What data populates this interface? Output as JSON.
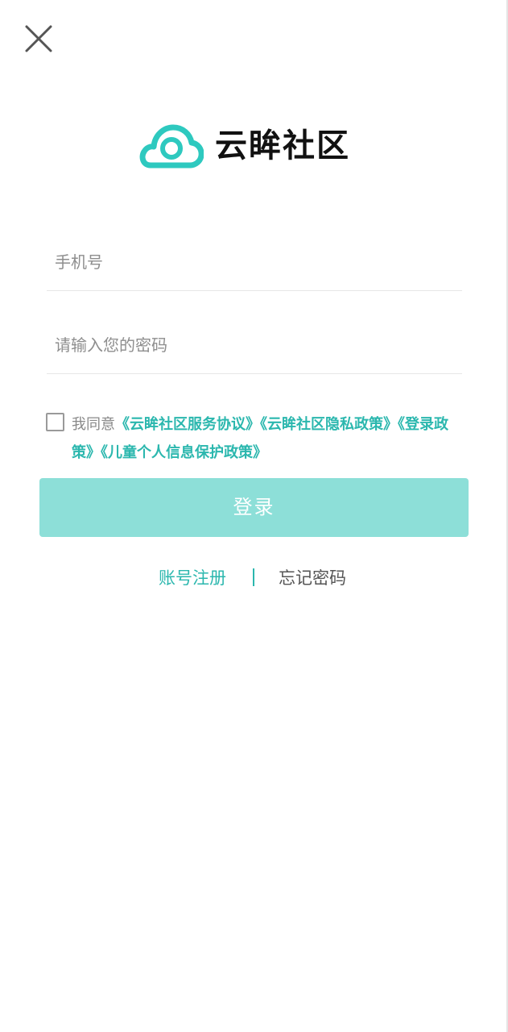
{
  "header": {
    "close_icon": "close-icon"
  },
  "logo": {
    "icon": "cloud-logo-icon",
    "text": "云眸社区",
    "brand_color": "#2ec9bf"
  },
  "form": {
    "phone_placeholder": "手机号",
    "phone_value": "",
    "password_placeholder": "请输入您的密码",
    "password_value": ""
  },
  "agreement": {
    "checked": false,
    "prefix": "我同意",
    "links": [
      "《云眸社区服务协议》",
      "《云眸社区隐私政策》",
      "《登录政策》",
      "《儿童个人信息保护政策》"
    ]
  },
  "login_button": {
    "label": "登录",
    "color": "#8ddfd8"
  },
  "bottom_links": {
    "register": "账号注册",
    "forgot_password": "忘记密码"
  },
  "colors": {
    "accent": "#2bb7ae",
    "text_gray": "#888888"
  }
}
